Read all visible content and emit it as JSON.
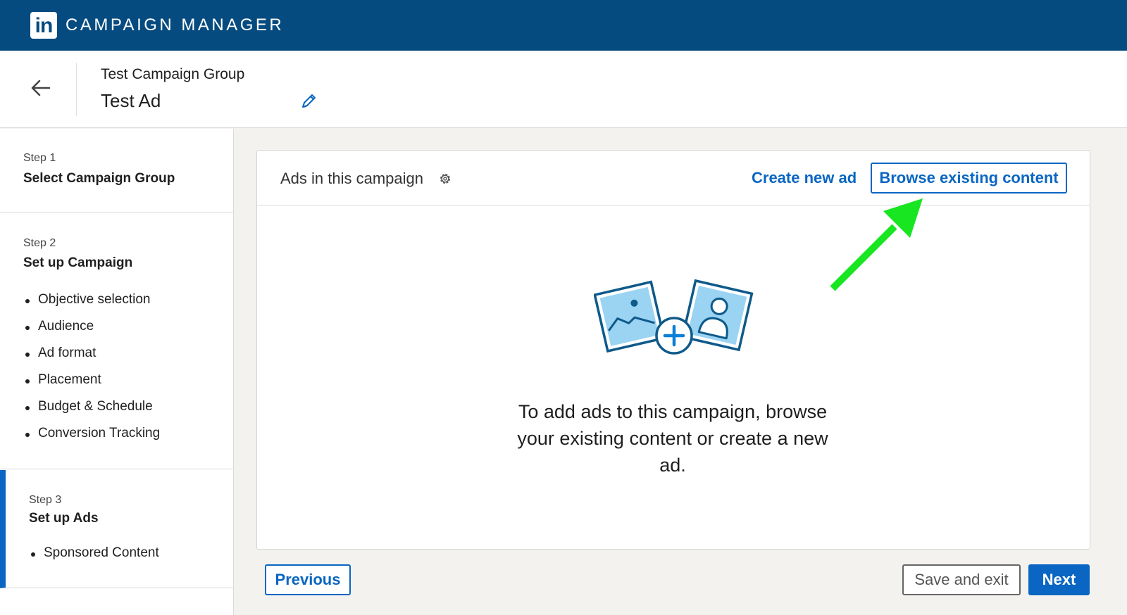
{
  "topbar": {
    "logo_text": "in",
    "brand": "CAMPAIGN MANAGER"
  },
  "header": {
    "group_title": "Test Campaign Group",
    "ad_title": "Test Ad"
  },
  "sidebar": {
    "steps": [
      {
        "num": "Step 1",
        "title": "Select Campaign Group",
        "items": []
      },
      {
        "num": "Step 2",
        "title": "Set up Campaign",
        "items": [
          "Objective selection",
          "Audience",
          "Ad format",
          "Placement",
          "Budget & Schedule",
          "Conversion Tracking"
        ]
      },
      {
        "num": "Step 3",
        "title": "Set up Ads",
        "items": [
          "Sponsored Content"
        ]
      }
    ]
  },
  "card": {
    "title": "Ads in this campaign",
    "create_link": "Create new ad",
    "browse_button": "Browse existing content",
    "empty_message": "To add ads to this campaign, browse your existing content or create a new ad."
  },
  "footer": {
    "previous": "Previous",
    "save_exit": "Save and exit",
    "next": "Next"
  },
  "colors": {
    "topbar": "#064b7f",
    "accent": "#0a66c2",
    "annotation_arrow": "#17e620"
  },
  "icons": [
    "linkedin-logo",
    "back-arrow-icon",
    "pencil-icon",
    "gear-icon",
    "image-plus-person-icon"
  ]
}
